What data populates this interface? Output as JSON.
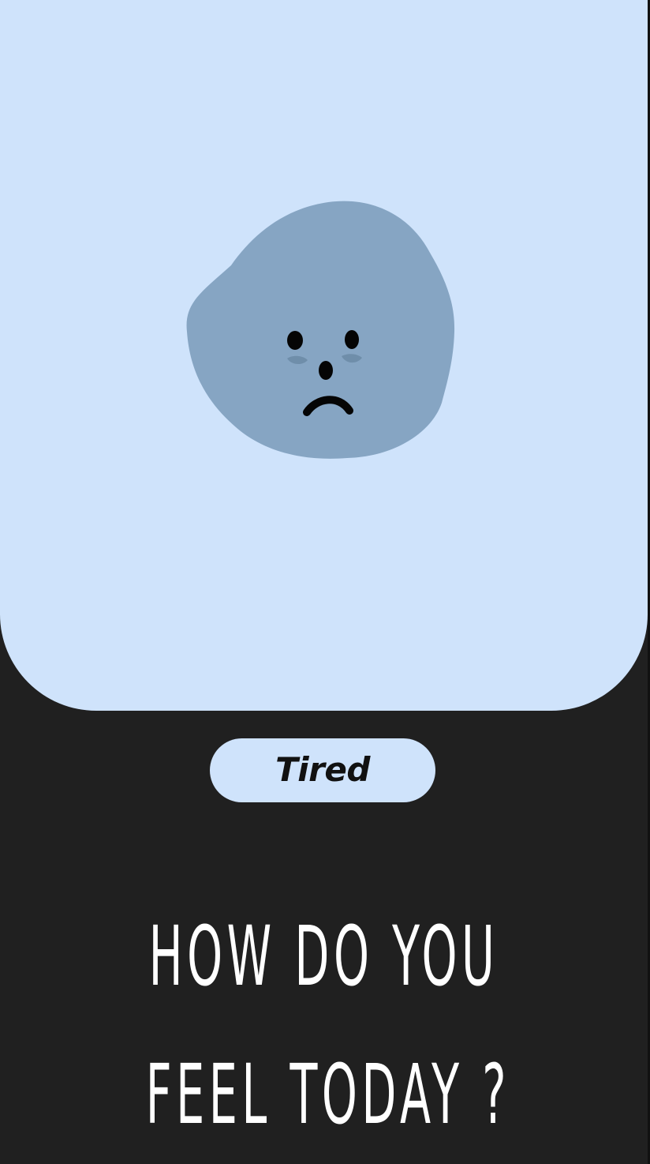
{
  "mood": {
    "label": "Tired",
    "face_icon": "tired-face-icon",
    "face_color": "#86a5c3"
  },
  "prompt": {
    "line1": "HOW DO YOU",
    "line2": "FEEL TODAY ?"
  },
  "colors": {
    "background": "#202020",
    "card": "#cfe3fb",
    "text": "#ffffff",
    "label_text": "#111111"
  }
}
